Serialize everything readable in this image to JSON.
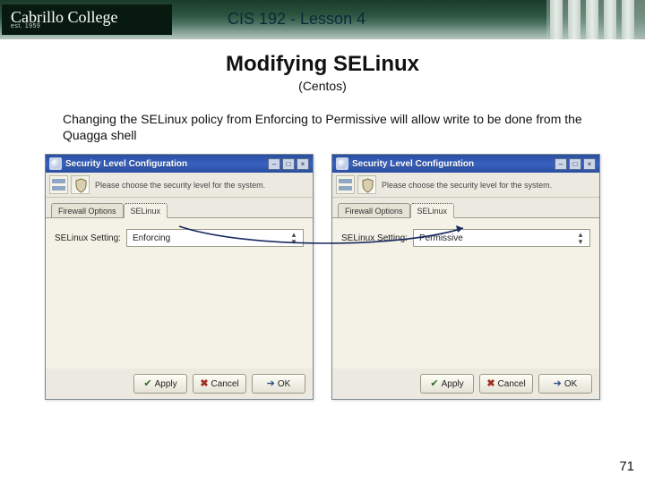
{
  "header": {
    "logo_name": "Cabrillo College",
    "logo_est": "est. 1959",
    "course_title": "CIS 192 - Lesson 4"
  },
  "slide": {
    "title": "Modifying SELinux",
    "subtitle": "(Centos)",
    "description": "Changing the SELinux policy from Enforcing to Permissive will allow write to be done from the Quagga shell"
  },
  "dialog": {
    "window_title": "Security Level Configuration",
    "instruction": "Please choose the security level for the system.",
    "tab_firewall": "Firewall Options",
    "tab_selinux": "SELinux",
    "setting_label": "SELinux Setting:",
    "buttons": {
      "apply": "Apply",
      "cancel": "Cancel",
      "ok": "OK"
    }
  },
  "left_dialog": {
    "selinux_value": "Enforcing"
  },
  "right_dialog": {
    "selinux_value": "Permissive"
  },
  "page_number": "71"
}
